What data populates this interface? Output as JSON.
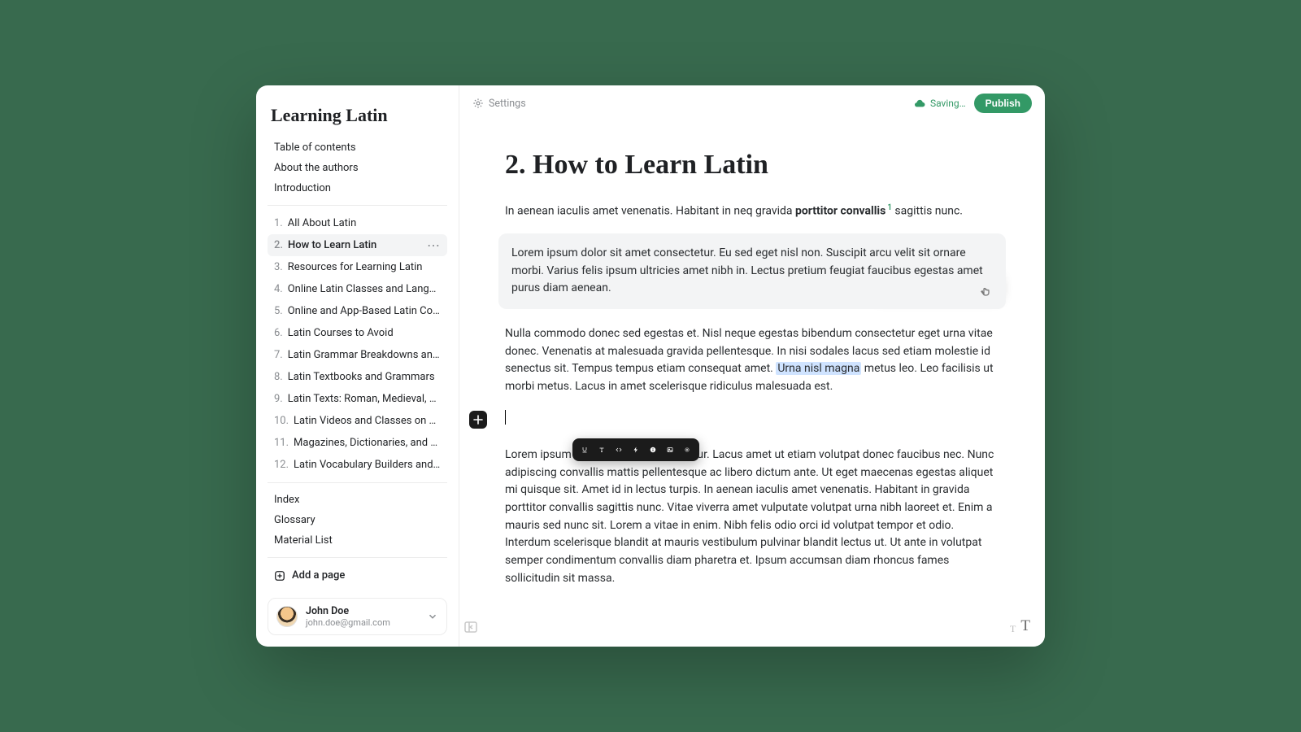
{
  "app_title": "Learning Latin",
  "sidebar_front": [
    "Table of contents",
    "About the authors",
    "Introduction"
  ],
  "chapters": [
    "All About Latin",
    "How to Learn Latin",
    "Resources for Learning Latin",
    "Online Latin Classes and Language Exchanges",
    "Online and App-Based Latin Courses",
    "Latin Courses to Avoid",
    "Latin Grammar Breakdowns and Guides",
    "Latin Textbooks and Grammars",
    "Latin Texts: Roman, Medieval, and Modern Readers",
    "Latin Videos and Classes on YouTube",
    "Magazines, Dictionaries, and Other Resources",
    "Latin Vocabulary Builders and Word Games"
  ],
  "active_chapter_index": 1,
  "sidebar_back": [
    "Index",
    "Glossary",
    "Material List"
  ],
  "add_page_label": "Add a page",
  "user": {
    "name": "John Doe",
    "email": "john.doe@gmail.com"
  },
  "topbar": {
    "settings": "Settings",
    "saving": "Saving…",
    "publish": "Publish"
  },
  "page_title": "2. How to Learn Latin",
  "body": {
    "intro_a": "In aenean iaculis amet venenatis. Habitant in neq gravida ",
    "intro_bold": "porttitor convallis",
    "intro_sup": "1",
    "intro_b": " sagittis nunc.",
    "callout": "Lorem ipsum dolor sit amet consectetur. Eu sed eget nisl non. Suscipit arcu velit sit ornare morbi. Varius felis ipsum ultricies amet nibh in. Lectus pretium feugiat faucibus egestas amet purus diam aenean.",
    "para2_a": "Nulla commodo donec sed egestas et. Nisl neque egestas bibendum consectetur eget urna vitae donec. Venenatis at malesuada gravida pellentesque. In nisi sodales lacus sed etiam molestie id senectus sit. Tempus tempus etiam consequat amet. ",
    "para2_highlight": "Urna nisl magna",
    "para2_b": " metus leo. Leo facilisis ut morbi metus. Lacus in amet scelerisque ridiculus malesuada est.",
    "para3": "Lorem ipsum dolor sit amet consectetur. Lacus amet ut etiam volutpat donec faucibus nec. Nunc adipiscing convallis mattis pellentesque ac libero dictum ante. Ut eget maecenas egestas aliquet mi quisque sit. Amet id in lectus turpis. In aenean iaculis amet venenatis. Habitant in gravida porttitor convallis sagittis nunc. Vitae viverra amet vulputate volutpat urna nibh laoreet et. Enim a mauris sed nunc sit. Lorem a vitae in enim. Nibh felis odio orci id volutpat tempor et odio. Interdum scelerisque blandit at mauris vestibulum pulvinar blandit lectus ut. Ut ante in volutpat semper condimentum convallis diam pharetra et. Ipsum accumsan diam rhoncus fames sollicitudin sit massa."
  },
  "toolbar_icons": [
    "underline",
    "type",
    "code",
    "bolt",
    "info",
    "image",
    "gear"
  ],
  "accent": "#339966"
}
